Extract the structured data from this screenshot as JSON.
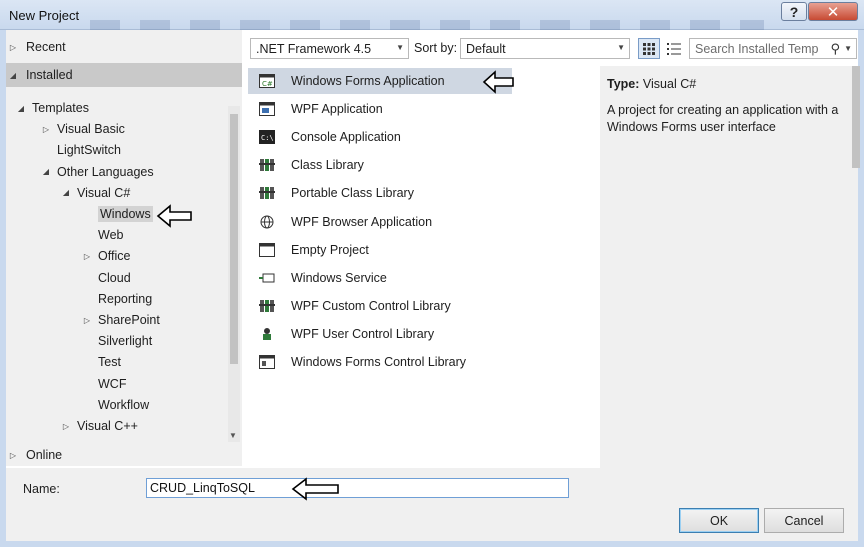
{
  "window": {
    "title": "New Project",
    "help_glyph": "?",
    "close_glyph": "✕"
  },
  "left": {
    "recent": "Recent",
    "installed": "Installed",
    "online": "Online",
    "tree": [
      {
        "label": "Templates",
        "arrow": "◢",
        "indent": 0
      },
      {
        "label": "Visual Basic",
        "arrow": "▷",
        "indent": 1
      },
      {
        "label": "LightSwitch",
        "arrow": "",
        "indent": 1
      },
      {
        "label": "Other Languages",
        "arrow": "◢",
        "indent": 1
      },
      {
        "label": "Visual C#",
        "arrow": "◢",
        "indent": 2
      },
      {
        "label": "Windows",
        "arrow": "",
        "indent": 3,
        "selected": true
      },
      {
        "label": "Web",
        "arrow": "",
        "indent": 3
      },
      {
        "label": "Office",
        "arrow": "▷",
        "indent": 3
      },
      {
        "label": "Cloud",
        "arrow": "",
        "indent": 3
      },
      {
        "label": "Reporting",
        "arrow": "",
        "indent": 3
      },
      {
        "label": "SharePoint",
        "arrow": "▷",
        "indent": 3
      },
      {
        "label": "Silverlight",
        "arrow": "",
        "indent": 3
      },
      {
        "label": "Test",
        "arrow": "",
        "indent": 3
      },
      {
        "label": "WCF",
        "arrow": "",
        "indent": 3
      },
      {
        "label": "Workflow",
        "arrow": "",
        "indent": 3
      },
      {
        "label": "Visual C++",
        "arrow": "▷",
        "indent": 2
      }
    ]
  },
  "toolbar": {
    "framework": ".NET Framework 4.5",
    "sort_label": "Sort by:",
    "sort_value": "Default",
    "search_placeholder": "Search Installed Temp"
  },
  "templates": [
    {
      "label": "Windows Forms Application",
      "icon": "winforms-app-icon",
      "selected": true
    },
    {
      "label": "WPF Application",
      "icon": "wpf-app-icon"
    },
    {
      "label": "Console Application",
      "icon": "console-app-icon"
    },
    {
      "label": "Class Library",
      "icon": "class-library-icon"
    },
    {
      "label": "Portable Class Library",
      "icon": "portable-class-library-icon"
    },
    {
      "label": "WPF Browser Application",
      "icon": "wpf-browser-app-icon"
    },
    {
      "label": "Empty Project",
      "icon": "empty-project-icon"
    },
    {
      "label": "Windows Service",
      "icon": "windows-service-icon"
    },
    {
      "label": "WPF Custom Control Library",
      "icon": "wpf-custom-control-icon"
    },
    {
      "label": "WPF User Control Library",
      "icon": "wpf-user-control-icon"
    },
    {
      "label": "Windows Forms Control Library",
      "icon": "winforms-control-icon"
    }
  ],
  "description": {
    "type_label": "Type:",
    "type_value": "Visual C#",
    "text": "A project for creating an application with a Windows Forms user interface"
  },
  "bottom": {
    "name_label": "Name:",
    "name_value": "CRUD_LinqToSQL",
    "ok": "OK",
    "cancel": "Cancel"
  }
}
